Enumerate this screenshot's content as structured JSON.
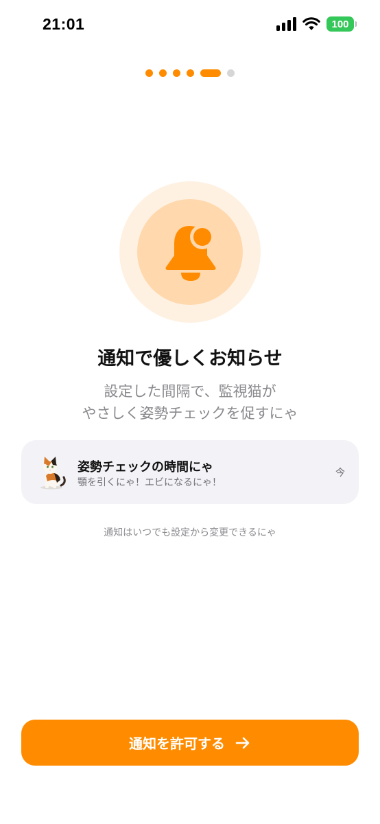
{
  "status_bar": {
    "time": "21:01",
    "battery": "100",
    "icons": [
      "cellular-signal-icon",
      "wifi-icon",
      "battery-icon"
    ]
  },
  "progress": {
    "total_steps": 6,
    "current_step": 5
  },
  "hero": {
    "icon": "bell-icon",
    "accent_color": "#ff8c00"
  },
  "title": "通知で優しくお知らせ",
  "subtitle_lines": [
    "設定した間隔で、監視猫が",
    "やさしく姿勢チェックを促すにゃ"
  ],
  "notification_preview": {
    "icon": "cat-icon",
    "title": "姿勢チェックの時間にゃ",
    "body": "顎を引くにゃ！エビになるにゃ！",
    "time": "今"
  },
  "helper_text": "通知はいつでも設定から変更できるにゃ",
  "cta": {
    "label": "通知を許可する",
    "icon": "arrow-right-icon",
    "color": "#ff8c00"
  }
}
